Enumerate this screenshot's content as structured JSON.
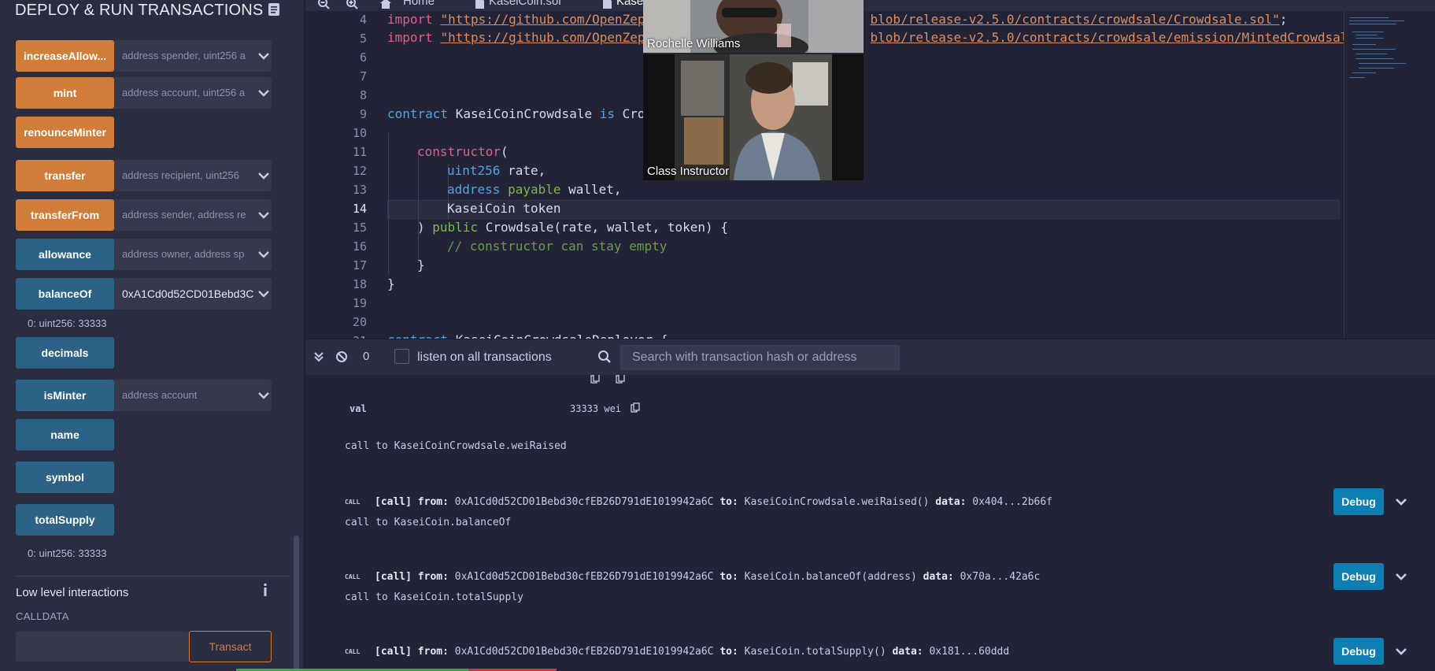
{
  "panel": {
    "title": "DEPLOY & RUN TRANSACTIONS",
    "functions": [
      {
        "label": "increaseAllow...",
        "placeholder": "address spender, uint256 a",
        "value": "",
        "style": "orange",
        "expandable": true
      },
      {
        "label": "mint",
        "placeholder": "address account, uint256 a",
        "value": "",
        "style": "orange",
        "expandable": true
      },
      {
        "label": "renounceMinter",
        "placeholder": "",
        "value": "",
        "style": "orange",
        "expandable": false
      },
      {
        "label": "transfer",
        "placeholder": "address recipient, uint256",
        "value": "",
        "style": "orange",
        "expandable": true
      },
      {
        "label": "transferFrom",
        "placeholder": "address sender, address re",
        "value": "",
        "style": "orange",
        "expandable": true
      },
      {
        "label": "allowance",
        "placeholder": "address owner, address sp",
        "value": "",
        "style": "blue",
        "expandable": true
      },
      {
        "label": "balanceOf",
        "placeholder": "",
        "value": "0xA1Cd0d52CD01Bebd3C",
        "style": "blue",
        "expandable": true
      },
      {
        "label": "decimals",
        "placeholder": "",
        "value": "",
        "style": "blue",
        "expandable": false
      },
      {
        "label": "isMinter",
        "placeholder": "address account",
        "value": "",
        "style": "blue",
        "expandable": true
      },
      {
        "label": "name",
        "placeholder": "",
        "value": "",
        "style": "blue",
        "expandable": false
      },
      {
        "label": "symbol",
        "placeholder": "",
        "value": "",
        "style": "blue",
        "expandable": false
      },
      {
        "label": "totalSupply",
        "placeholder": "",
        "value": "",
        "style": "blue",
        "expandable": false
      }
    ],
    "results": {
      "balanceOf": "0: uint256: 33333",
      "totalSupply": "0: uint256: 33333"
    },
    "low_level": {
      "title": "Low level interactions",
      "calldata_label": "CALLDATA",
      "transact_label": "Transact"
    }
  },
  "tabs": [
    {
      "label": "Home"
    },
    {
      "label": "KaseiCoin.sol"
    },
    {
      "label": "Kasei"
    }
  ],
  "editor": {
    "active_line": "14",
    "lines": [
      {
        "n": "4"
      },
      {
        "n": "5"
      },
      {
        "n": "6"
      },
      {
        "n": "7"
      },
      {
        "n": "8"
      },
      {
        "n": "9"
      },
      {
        "n": "10"
      },
      {
        "n": "11"
      },
      {
        "n": "12"
      },
      {
        "n": "13"
      },
      {
        "n": "14"
      },
      {
        "n": "15"
      },
      {
        "n": "16"
      },
      {
        "n": "17"
      },
      {
        "n": "18"
      },
      {
        "n": "19"
      },
      {
        "n": "20"
      },
      {
        "n": "21"
      }
    ],
    "code": {
      "l4_import": "import",
      "l4_str": "\"https://github.com/OpenZep",
      "l4_str2": "blob/release-v2.5.0/contracts/crowdsale/Crowdsale.sol\"",
      "l4_end": ";",
      "l5_import": "import",
      "l5_str": "\"https://github.com/OpenZep",
      "l5_str2": "blob/release-v2.5.0/contracts/crowdsale/emission/MintedCrowdsale",
      "l9_contract": "contract",
      "l9_name": " KaseiCoinCrowdsale ",
      "l9_is": "is",
      "l9_rest": " Cro",
      "l11_constructor": "constructor",
      "l11_paren": "(",
      "l12_type": "uint256",
      "l12_rest": " rate,",
      "l13_type": "address",
      "l13_payable": " payable",
      "l13_rest": " wallet,",
      "l14_text": "KaseiCoin token",
      "l15_paren": ") ",
      "l15_public": "public",
      "l15_rest": " Crowdsale(rate, wallet, token) {",
      "l16_comment": "// constructor can stay empty",
      "l17_brace": "}",
      "l18_brace": "}",
      "l21_contract": "contract",
      "l21_rest": " KaseiCoinCrowdsaleDeployer {"
    }
  },
  "video": {
    "participant1": "Rochelle Williams",
    "participant2": "Class Instructor"
  },
  "terminal_bar": {
    "count": "0",
    "listen_label": "listen on all transactions",
    "search_placeholder": "Search with transaction hash or address"
  },
  "terminal": {
    "val_key": "val",
    "val_value": "33333 wei",
    "call_to_1": "call to KaseiCoinCrowdsale.weiRaised",
    "transactions": [
      {
        "kind": "CALL",
        "text_call": "[call]",
        "from_label": "from:",
        "from": "0xA1Cd0d52CD01Bebd30cfEB26D791dE1019942a6C",
        "to_label": "to:",
        "to": "KaseiCoinCrowdsale.weiRaised()",
        "data_label": "data:",
        "data": "0x404...2b66f",
        "debug": "Debug",
        "after": "call to KaseiCoin.balanceOf"
      },
      {
        "kind": "CALL",
        "text_call": "[call]",
        "from_label": "from:",
        "from": "0xA1Cd0d52CD01Bebd30cfEB26D791dE1019942a6C",
        "to_label": "to:",
        "to": "KaseiCoin.balanceOf(address)",
        "data_label": "data:",
        "data": "0x70a...42a6c",
        "debug": "Debug",
        "after": "call to KaseiCoin.totalSupply"
      },
      {
        "kind": "CALL",
        "text_call": "[call]",
        "from_label": "from:",
        "from": "0xA1Cd0d52CD01Bebd30cfEB26D791dE1019942a6C",
        "to_label": "to:",
        "to": "KaseiCoin.totalSupply()",
        "data_label": "data:",
        "data": "0x181...60ddd",
        "debug": "Debug",
        "after": ""
      }
    ]
  },
  "colors": {
    "accent_orange": "#d17d3a",
    "accent_blue": "#2c6286",
    "debug_blue": "#0e7fb3",
    "background": "#222336",
    "panel": "#2a2c3f"
  },
  "icons": {
    "panel_doc": "document-icon",
    "zoom_out": "zoom-out-icon",
    "zoom_in": "zoom-in-icon",
    "home": "home-icon",
    "file": "file-icon",
    "info": "info-icon",
    "collapse": "double-chevron-down-icon",
    "clear": "ban-icon",
    "search": "search-icon",
    "copy": "copy-icon",
    "expand": "chevron-down-icon"
  }
}
